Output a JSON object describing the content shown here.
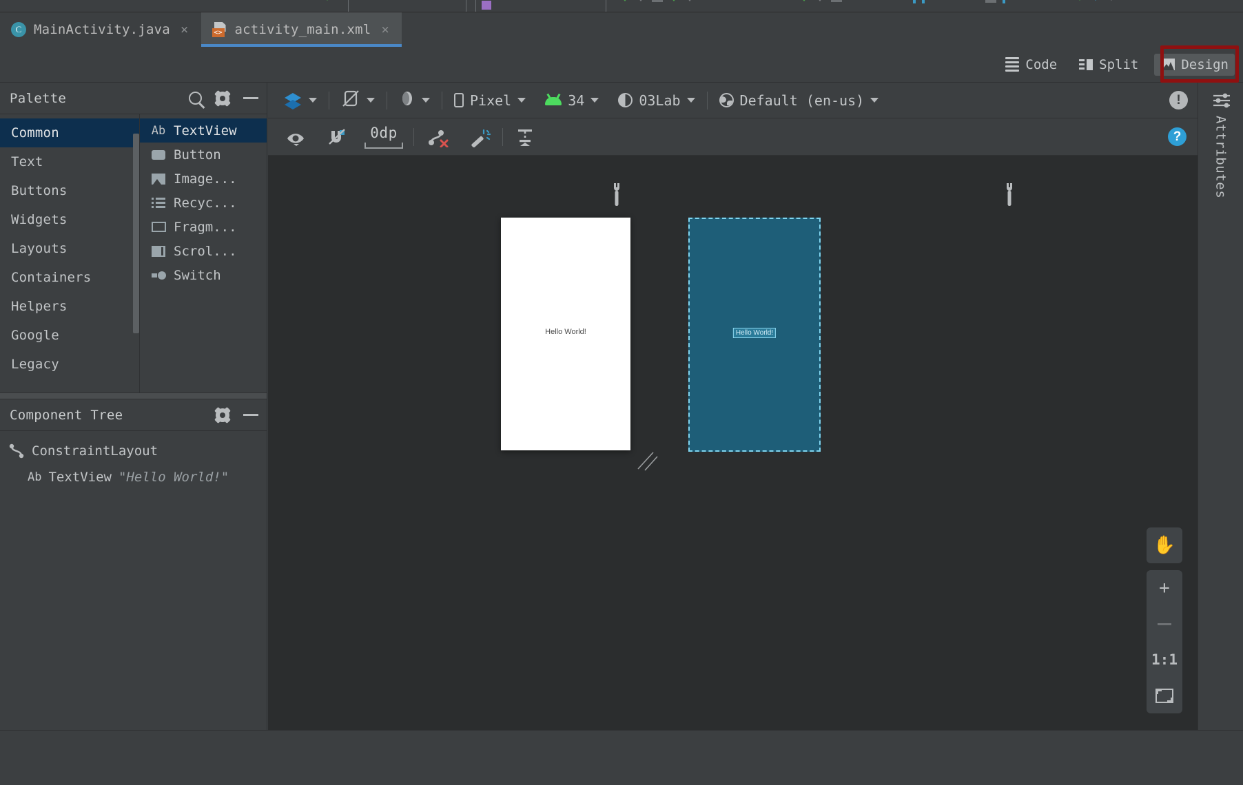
{
  "tabs": [
    {
      "label": "MainActivity.java",
      "icon": "java-class-icon",
      "active": false,
      "close": "×"
    },
    {
      "label": "activity_main.xml",
      "icon": "xml-layout-icon",
      "active": true,
      "close": "×"
    }
  ],
  "editor_modes": [
    {
      "label": "Code",
      "icon": "code-view-icon",
      "selected": false
    },
    {
      "label": "Split",
      "icon": "split-view-icon",
      "selected": false
    },
    {
      "label": "Design",
      "icon": "design-view-icon",
      "selected": true,
      "highlighted": true
    }
  ],
  "palette": {
    "title": "Palette",
    "search_icon": "search-icon",
    "gear_icon": "gear-icon",
    "minimize_icon": "minimize-icon",
    "categories": [
      {
        "label": "Common",
        "selected": true
      },
      {
        "label": "Text",
        "selected": false
      },
      {
        "label": "Buttons",
        "selected": false
      },
      {
        "label": "Widgets",
        "selected": false
      },
      {
        "label": "Layouts",
        "selected": false
      },
      {
        "label": "Containers",
        "selected": false
      },
      {
        "label": "Helpers",
        "selected": false
      },
      {
        "label": "Google",
        "selected": false
      },
      {
        "label": "Legacy",
        "selected": false
      }
    ],
    "items": [
      {
        "label": "TextView",
        "icon": "textview-icon",
        "selected": true
      },
      {
        "label": "Button",
        "icon": "button-icon",
        "selected": false
      },
      {
        "label": "Image...",
        "icon": "imageview-icon",
        "selected": false
      },
      {
        "label": "Recyc...",
        "icon": "recyclerview-icon",
        "selected": false
      },
      {
        "label": "Fragm...",
        "icon": "fragment-icon",
        "selected": false
      },
      {
        "label": "Scrol...",
        "icon": "scrollview-icon",
        "selected": false
      },
      {
        "label": "Switch",
        "icon": "switch-icon",
        "selected": false
      }
    ]
  },
  "component_tree": {
    "title": "Component Tree",
    "gear_icon": "gear-icon",
    "minimize_icon": "minimize-icon",
    "nodes": [
      {
        "type": "ConstraintLayout",
        "value": "",
        "icon": "constraintlayout-icon",
        "indent": 0
      },
      {
        "type": "TextView",
        "value": "\"Hello World!\"",
        "icon": "textview-icon",
        "indent": 1
      }
    ]
  },
  "design_toolbar": {
    "layers_icon": "layers-icon",
    "orientation_icon": "rotate-orientation-icon",
    "theme_circle_icon": "ui-mode-icon",
    "device": "Pixel",
    "api_level": "34",
    "theme": "03Lab",
    "locale": "Default (en-us)",
    "warning_icon": "warning-icon"
  },
  "constraint_toolbar": {
    "view_options_icon": "eye-view-options-icon",
    "autoconnect_icon": "autoconnect-off-icon",
    "default_margin": "0dp",
    "clear_constraints_icon": "clear-constraints-icon",
    "infer_constraints_icon": "magic-wand-infer-icon",
    "align_icon": "align-guidelines-icon",
    "help_icon": "help-icon"
  },
  "canvas": {
    "design_preview": {
      "label": "Hello World!",
      "surface_color": "#ffffff",
      "text_color": "#4a4a4a"
    },
    "blueprint_preview": {
      "label": "Hello World!",
      "surface_color": "#1e5e78",
      "outline_color": "#7fd5f0",
      "selection_color": "#2a7b99"
    },
    "wrench_icon": "render-settings-wrench-icon",
    "resize_handle_icon": "resize-handle-icon"
  },
  "zoom_controls": {
    "pan_label": "✋",
    "pan_icon": "pan-hand-icon",
    "zoom_in": "+",
    "zoom_in_icon": "zoom-in-icon",
    "zoom_out_icon": "zoom-out-icon",
    "actual_size": "1:1",
    "actual_size_icon": "actual-size-icon",
    "fit_icon": "zoom-to-fit-icon"
  },
  "attributes_rail": {
    "label": "Attributes",
    "icon": "sliders-attributes-icon"
  },
  "colors": {
    "accent_blue": "#4a88c7",
    "selection_navy": "#0d2f4e",
    "highlight_red": "#8f1010",
    "blueprint_teal": "#1e5e78",
    "android_green": "#4ddb5f",
    "panel_bg": "#3c3f41",
    "canvas_bg": "#2b2d2e"
  }
}
